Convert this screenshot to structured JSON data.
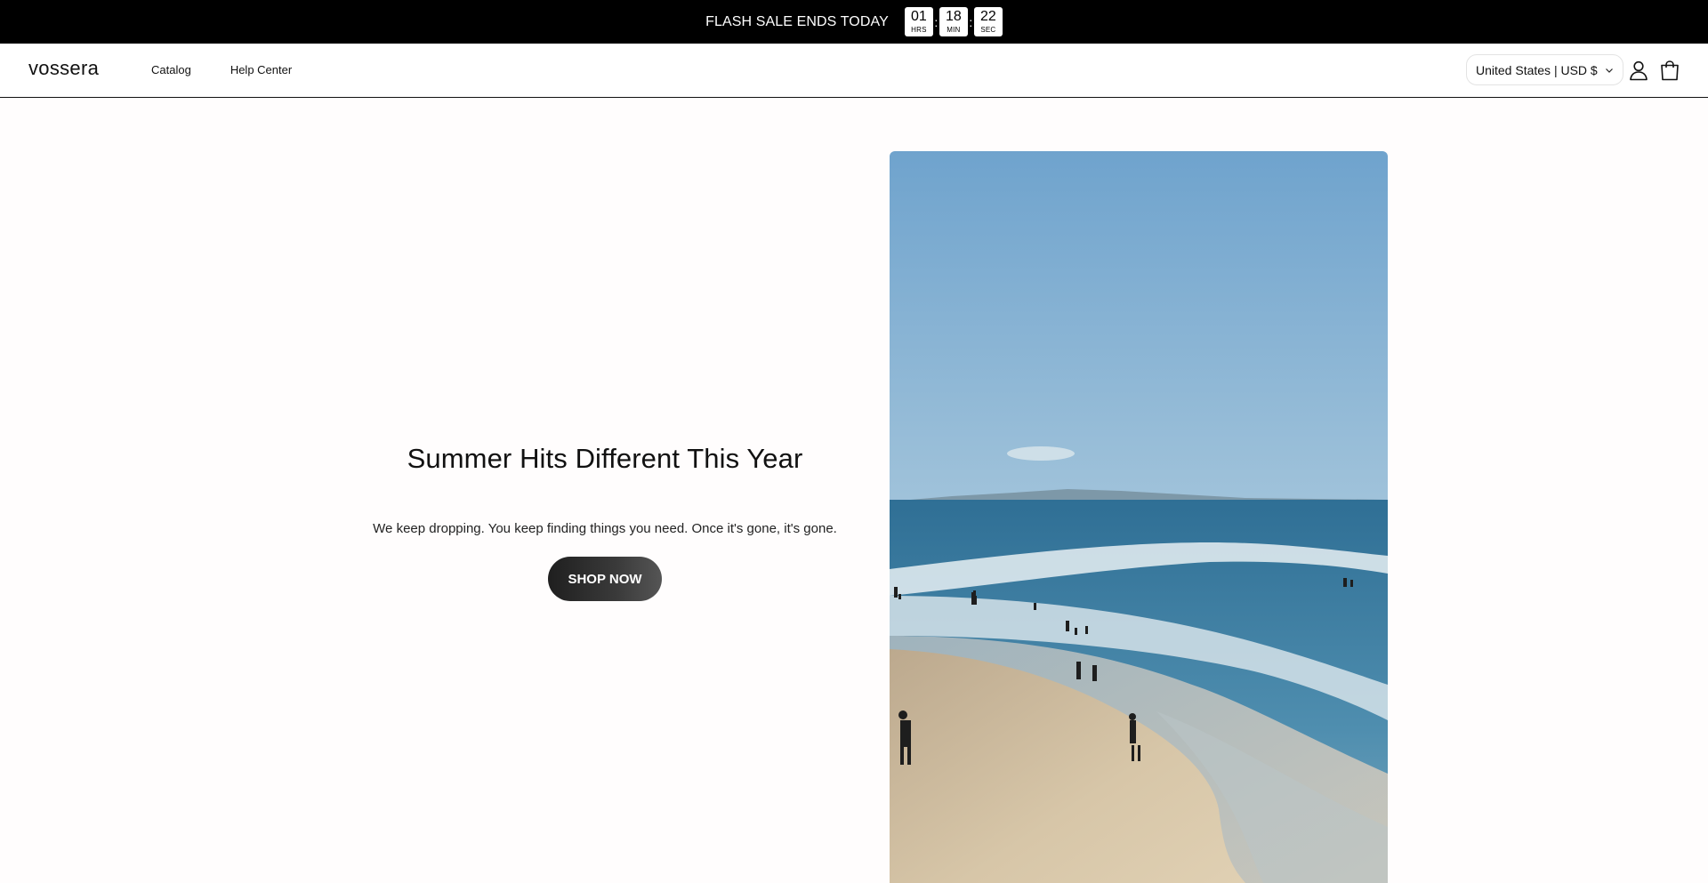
{
  "announcement": {
    "message": "FLASH SALE ENDS TODAY",
    "timer": [
      {
        "value": "01",
        "unit": "HRS"
      },
      {
        "value": "18",
        "unit": "MIN"
      },
      {
        "value": "22",
        "unit": "SEC"
      }
    ],
    "separator": ":"
  },
  "header": {
    "logo": "vossera",
    "nav": [
      {
        "label": "Catalog"
      },
      {
        "label": "Help Center"
      }
    ],
    "region_selector": "United States | USD $",
    "icons": [
      "account-icon",
      "cart-icon",
      "chevron-down-icon"
    ]
  },
  "hero": {
    "title": "Summer Hits Different This Year",
    "subtitle": "We keep dropping. You keep finding things you need. Once it's gone, it's gone.",
    "cta_label": "SHOP NOW"
  },
  "colors": {
    "announcement_bg": "#000000",
    "cta_bg": "#2b2b2b",
    "page_bg": "#fffdfd"
  }
}
